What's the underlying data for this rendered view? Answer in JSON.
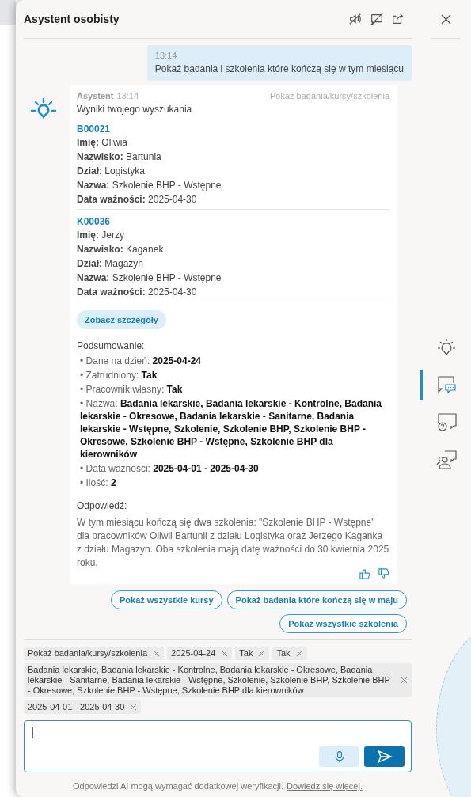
{
  "panel": {
    "title": "Asystent osobisty"
  },
  "messages": [
    {
      "kind": "user",
      "time": "13:14",
      "text": "Pokaż badania i szkolenia które kończą się w tym miesiącu"
    },
    {
      "kind": "assistant",
      "sender": "Asystent",
      "time": "13:14",
      "topic": "Pokaż badania/kursy/szkolenia",
      "intro": "Wyniki twojego wyszukania",
      "records": [
        {
          "id": "B00021",
          "fields": [
            "**Imię:** Oliwia",
            "**Nazwisko:** Bartunia",
            "**Dział:** Logistyka",
            "**Nazwa:** Szkolenie BHP - Wstępne",
            "**Data ważności:** 2025-04-30"
          ]
        },
        {
          "id": "K00036",
          "fields": [
            "**Imię:** Jerzy",
            "**Nazwisko:** Kaganek",
            "**Dział:** Magazyn",
            "**Nazwa:** Szkolenie BHP - Wstępne",
            "**Data ważności:** 2025-04-30"
          ]
        }
      ],
      "details_button": "Zobacz szczegóły",
      "summary_title": "Podsumowanie:",
      "summary": [
        "• Dane na dzień: **2025-04-24**",
        "• Zatrudniony: **Tak**",
        "• Pracownik własny: **Tak**",
        "• Nazwa: **Badania lekarskie, Badania lekarskie - Kontrolne, Badania lekarskie - Okresowe, Badania lekarskie - Sanitarne, Badania lekarskie - Wstępne, Szkolenie, Szkolenie BHP, Szkolenie BHP - Okresowe, Szkolenie BHP - Wstępne, Szkolenie BHP dla kierowników**",
        "• Data ważności: **2025-04-01 - 2025-04-30**",
        "• Ilość: **2**"
      ],
      "answer_title": "Odpowiedź:",
      "answer": "W tym miesiącu kończą się dwa szkolenia: \"Szkolenie BHP - Wstępne\" dla pracowników Oliwii Bartunii z działu Logistyka oraz Jerzego Kaganka z działu Magazyn. Oba szkolenia mają datę ważności do 30 kwietnia 2025 roku."
    }
  ],
  "suggestions": [
    "Pokaż wszystkie kursy",
    "Pokaż badania które kończą się w maju",
    "Pokaż wszystkie szkolenia"
  ],
  "chips": [
    "Pokaż badania/kursy/szkolenia",
    "2025-04-24",
    "Tak",
    "Tak",
    "Badania lekarskie, Badania lekarskie - Kontrolne, Badania lekarskie - Okresowe, Badania lekarskie - Sanitarne, Badania lekarskie - Wstępne, Szkolenie, Szkolenie BHP, Szkolenie BHP - Okresowe, Szkolenie BHP - Wstępne, Szkolenie BHP dla kierowników",
    "2025-04-01 - 2025-04-30"
  ],
  "footer": {
    "text": "Odpowiedzi AI mogą wymagać dodatkowej weryfikacji.",
    "link": "Dowiedz się więcej."
  },
  "rail": {
    "items": [
      {
        "kind": "bulb",
        "selected": false
      },
      {
        "kind": "chat",
        "selected": true
      },
      {
        "kind": "help",
        "selected": false
      },
      {
        "kind": "people",
        "selected": false
      }
    ]
  }
}
